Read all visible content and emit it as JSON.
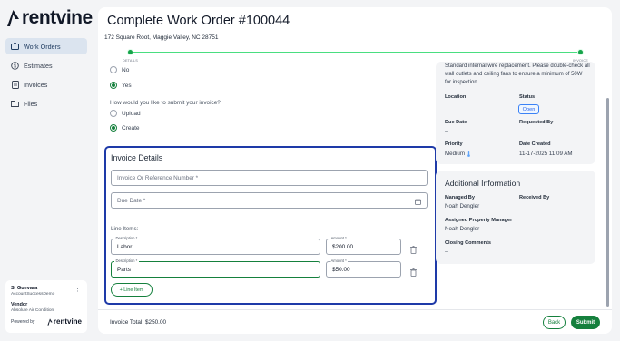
{
  "app": {
    "brand": "rentvine"
  },
  "sidebar": {
    "items": [
      {
        "label": "Work Orders",
        "icon": "work-orders-icon",
        "active": true
      },
      {
        "label": "Estimates",
        "icon": "estimates-icon",
        "active": false
      },
      {
        "label": "Invoices",
        "icon": "invoices-icon",
        "active": false
      },
      {
        "label": "Files",
        "icon": "files-icon",
        "active": false
      }
    ],
    "user": {
      "name": "S. Guevara",
      "account": "AccountSuccessDemo",
      "role_label": "Vendor",
      "company": "Absolute Air Condition",
      "powered_by": "Powered by",
      "powered_brand": "rentvine"
    }
  },
  "header": {
    "title": "Complete Work Order #100044",
    "address": "172 Square Root, Maggie Valley, NC 28751"
  },
  "progress": {
    "steps": [
      "DETAILS",
      "INVOICE"
    ],
    "completed": 2
  },
  "form": {
    "prev_options": [
      {
        "label": "No",
        "selected": false
      },
      {
        "label": "Yes",
        "selected": true
      }
    ],
    "submit_question": "How would you like to submit your invoice?",
    "submit_options": [
      {
        "label": "Upload",
        "selected": false
      },
      {
        "label": "Create",
        "selected": true
      }
    ]
  },
  "invoice": {
    "heading": "Invoice Details",
    "reference_placeholder": "Invoice Or Reference Number *",
    "due_date_placeholder": "Due Date *",
    "line_items_label": "Line Items:",
    "description_label": "Description *",
    "amount_label": "Amount *",
    "items": [
      {
        "description": "Labor",
        "amount": "$200.00"
      },
      {
        "description": "Parts",
        "amount": "$50.00"
      }
    ],
    "add_line_label": "+ Line Item"
  },
  "footer": {
    "total": "Invoice Total: $250.00",
    "back_label": "Back",
    "submit_label": "Submit"
  },
  "details": {
    "description": "Standard internal wire replacement. Please double-check all wall outlets and ceiling fans to ensure a minimum of 50W for inspection.",
    "location_label": "Location",
    "status_label": "Status",
    "status_value": "Open",
    "due_date_label": "Due Date",
    "due_date_value": "--",
    "requested_by_label": "Requested By",
    "priority_label": "Priority",
    "priority_value": "Medium",
    "date_created_label": "Date Created",
    "date_created_value": "11-17-2025 11:09 AM"
  },
  "additional": {
    "title": "Additional Information",
    "managed_by_label": "Managed By",
    "managed_by_value": "Noah Dengler",
    "received_by_label": "Received By",
    "assigned_pm_label": "Assigned Property Manager",
    "assigned_pm_value": "Noah Dengler",
    "closing_comments_label": "Closing Comments",
    "closing_comments_value": "--"
  },
  "colors": {
    "primary": "#15803d",
    "highlight": "#1e3aa8",
    "status": "#2563eb"
  }
}
